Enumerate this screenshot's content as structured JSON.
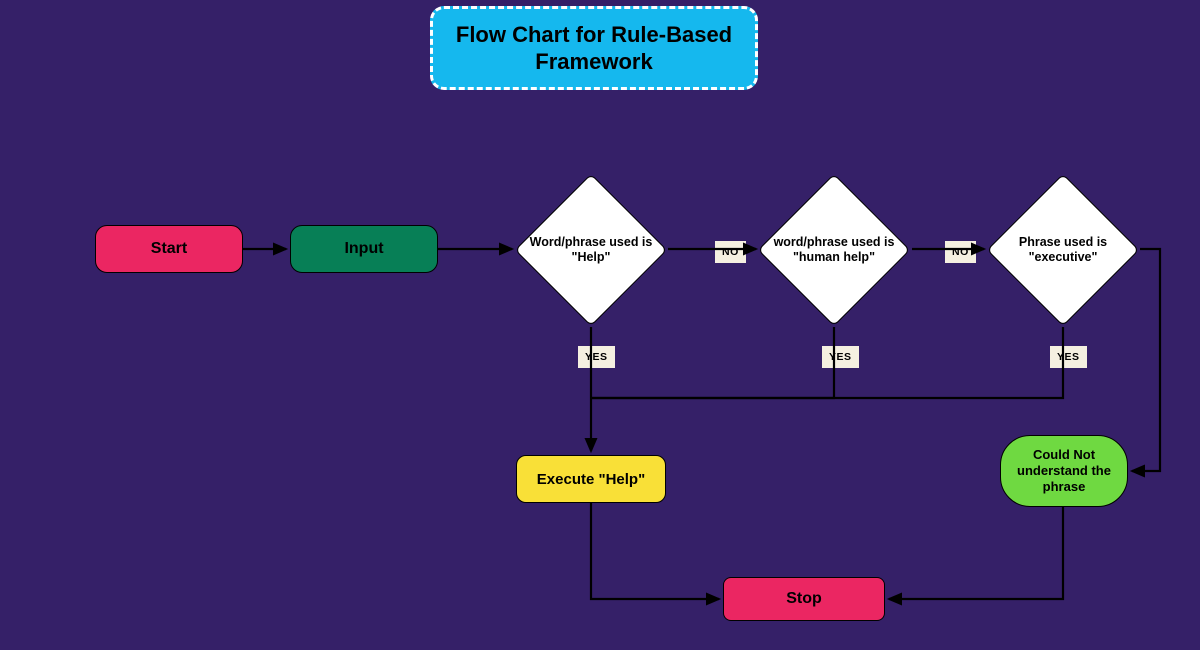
{
  "title": "Flow Chart for Rule-Based Framework",
  "start": "Start",
  "input": "Input",
  "dec1_pre": "Word/phrase used is",
  "dec1_kw": "\"Help\"",
  "dec2_pre": "word/phrase used is",
  "dec2_kw": "\"human help\"",
  "dec3_pre": "Phrase used is",
  "dec3_kw": "\"executive\"",
  "no": "NO",
  "yes": "YES",
  "execute": "Execute \"Help\"",
  "could_not": "Could Not understand the phrase",
  "stop": "Stop"
}
